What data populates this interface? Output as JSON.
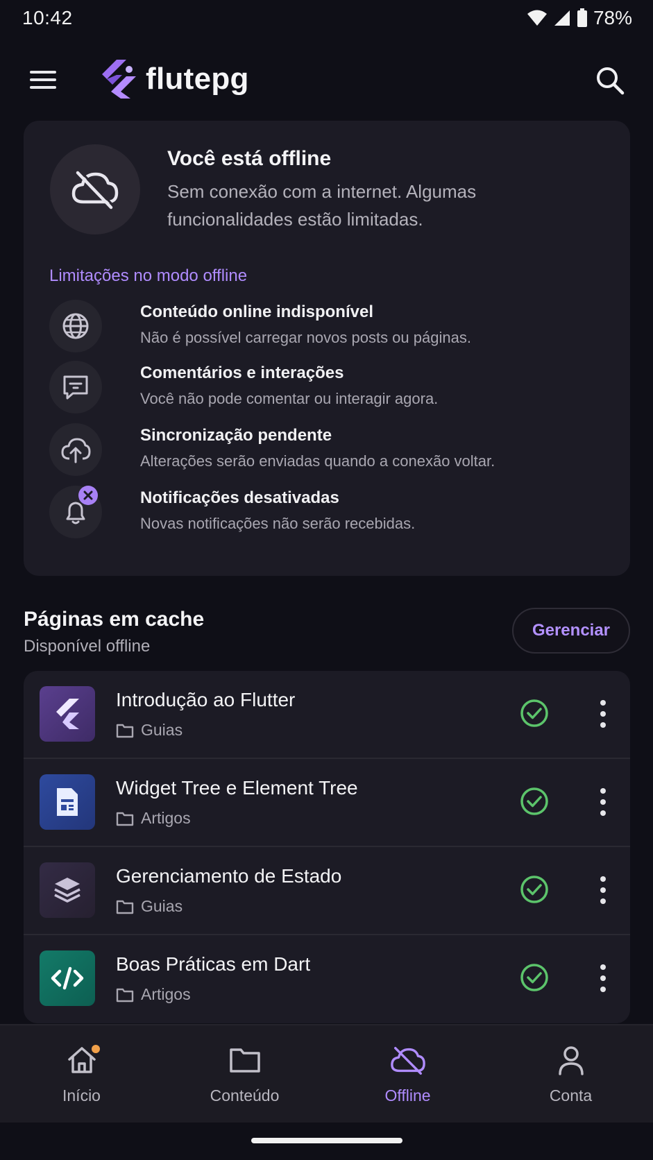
{
  "status_bar": {
    "time": "10:42",
    "battery": "78%"
  },
  "app_bar": {
    "title": "flutepg"
  },
  "offline_card": {
    "title": "Você está offline",
    "description": "Sem conexão com a internet. Algumas funcionalidades estão limitadas.",
    "limits_heading": "Limitações no modo offline",
    "limits": [
      {
        "icon": "globe-icon",
        "title": "Conteúdo online indisponível",
        "desc": "Não é possível carregar novos posts ou páginas."
      },
      {
        "icon": "comment-icon",
        "title": "Comentários e interações",
        "desc": "Você não pode comentar ou interagir agora."
      },
      {
        "icon": "cloud-upload-icon",
        "title": "Sincronização pendente",
        "desc": "Alterações serão enviadas quando a conexão voltar."
      },
      {
        "icon": "bell-off-icon",
        "title": "Notificações desativadas",
        "desc": "Novas notificações não serão recebidas."
      }
    ]
  },
  "cache": {
    "title": "Páginas em cache",
    "subtitle": "Disponível offline",
    "manage_label": "Gerenciar",
    "pages": [
      {
        "title": "Introdução ao Flutter",
        "category": "Guias",
        "icon": "flutter-icon"
      },
      {
        "title": "Widget Tree e Element Tree",
        "category": "Artigos",
        "icon": "article-icon"
      },
      {
        "title": "Gerenciamento de Estado",
        "category": "Guias",
        "icon": "layers-icon"
      },
      {
        "title": "Boas Práticas em Dart",
        "category": "Artigos",
        "icon": "code-icon"
      }
    ]
  },
  "bottom_nav": {
    "items": [
      {
        "label": "Início",
        "icon": "home-icon"
      },
      {
        "label": "Conteúdo",
        "icon": "folder-icon"
      },
      {
        "label": "Offline",
        "icon": "cloud-off-icon",
        "active": true
      },
      {
        "label": "Conta",
        "icon": "person-icon"
      }
    ]
  },
  "colors": {
    "background": "#0f0f17",
    "card": "#1c1b25",
    "accent": "#b08cff",
    "success": "#5cc46b"
  }
}
